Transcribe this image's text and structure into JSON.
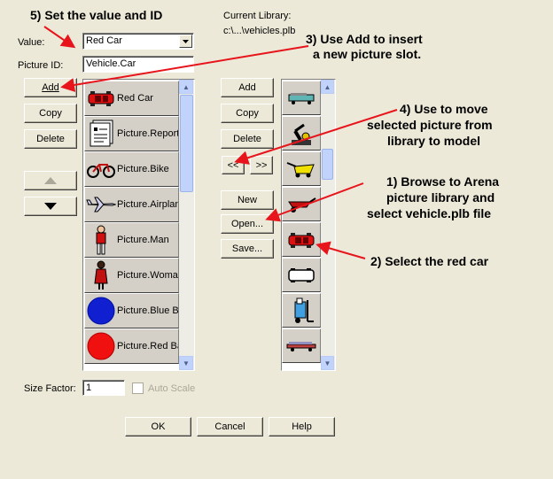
{
  "form": {
    "value_label": "Value:",
    "value": "Red Car",
    "picture_id_label": "Picture ID:",
    "picture_id": "Vehicle.Car",
    "current_library_label": "Current Library:",
    "current_library_path": "c:\\...\\vehicles.plb",
    "size_factor_label": "Size Factor:",
    "size_factor": "1",
    "auto_scale_label": "Auto Scale"
  },
  "model_buttons": {
    "add": "Add",
    "copy": "Copy",
    "delete": "Delete"
  },
  "library_buttons": {
    "add": "Add",
    "copy": "Copy",
    "delete": "Delete",
    "move_left": "<<",
    "move_right": ">>",
    "new": "New",
    "open": "Open...",
    "save": "Save..."
  },
  "model_pictures": [
    {
      "name": "Red Car",
      "icon": "red-car-icon"
    },
    {
      "name": "Picture.Report",
      "icon": "report-icon"
    },
    {
      "name": "Picture.Bike",
      "icon": "bike-icon"
    },
    {
      "name": "Picture.Airplane",
      "icon": "airplane-icon"
    },
    {
      "name": "Picture.Man",
      "icon": "man-icon"
    },
    {
      "name": "Picture.Woman",
      "icon": "woman-icon"
    },
    {
      "name": "Picture.Blue Ball",
      "icon": "blue-ball-icon"
    },
    {
      "name": "Picture.Red Ball",
      "icon": "red-ball-icon"
    }
  ],
  "library_pictures": [
    {
      "icon": "truck-icon"
    },
    {
      "icon": "robot-arm-icon"
    },
    {
      "icon": "yellow-cart-icon"
    },
    {
      "icon": "red-wheelbarrow-icon"
    },
    {
      "icon": "red-car-icon"
    },
    {
      "icon": "white-van-icon"
    },
    {
      "icon": "forklift-icon"
    },
    {
      "icon": "flatbed-icon"
    }
  ],
  "dialog_buttons": {
    "ok": "OK",
    "cancel": "Cancel",
    "help": "Help"
  },
  "annotations": {
    "step5": "5) Set the value and ID",
    "step3_line1": "3) Use Add to insert",
    "step3_line2": "a new picture slot.",
    "step4_line1": "4) Use to move",
    "step4_line2": "selected picture from",
    "step4_line3": "library to model",
    "step1_line1": "1) Browse to Arena",
    "step1_line2": "picture library and",
    "step1_line3": "select vehicle.plb file",
    "step2": "2) Select the red car"
  },
  "colors": {
    "annotation_arrow": "#E8141C",
    "dialog_bg": "#ECE9D8",
    "item_bg": "#D4D0C8"
  }
}
